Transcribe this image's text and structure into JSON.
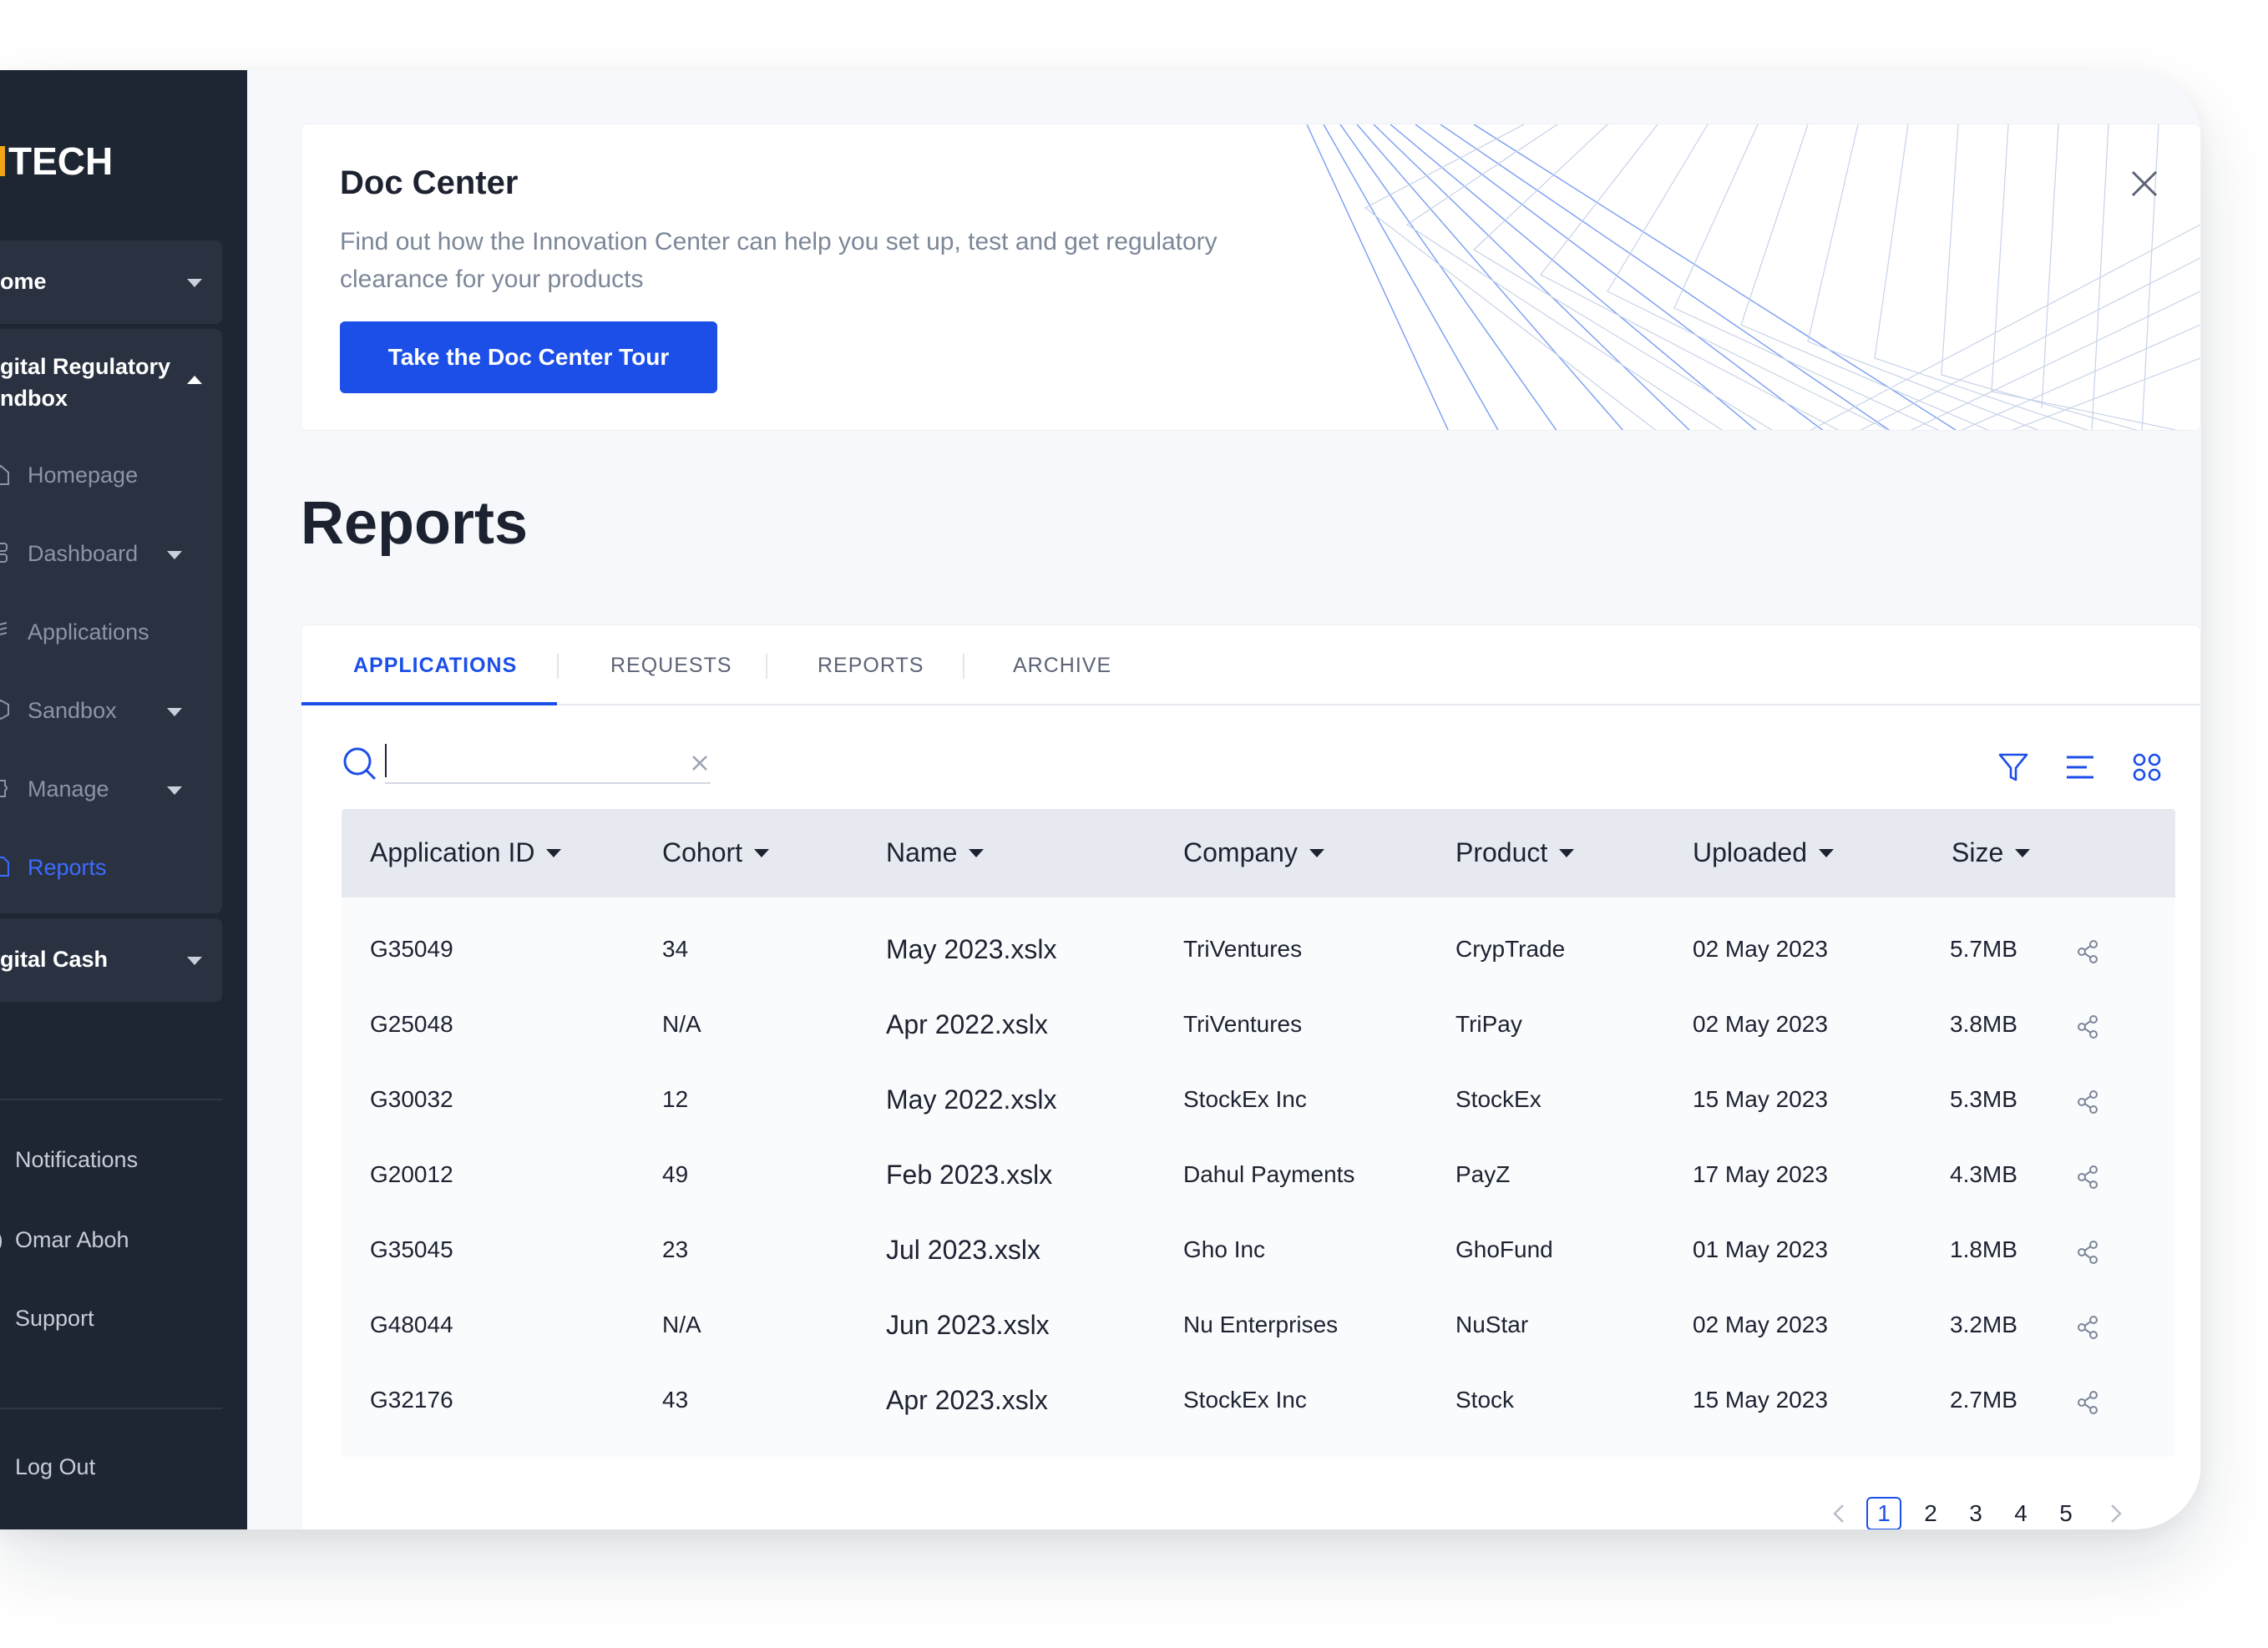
{
  "sidebar": {
    "logo": "TECH",
    "home": "ome",
    "group_title_line1": "gital Regulatory",
    "group_title_line2": "ndbox",
    "items": [
      {
        "label": "Homepage"
      },
      {
        "label": "Dashboard"
      },
      {
        "label": "Applications"
      },
      {
        "label": "Sandbox"
      },
      {
        "label": "Manage"
      },
      {
        "label": "Reports"
      }
    ],
    "cash": "gital Cash",
    "notifications": "Notifications",
    "user": "Omar Aboh",
    "support": "Support",
    "logout": "Log Out"
  },
  "banner": {
    "title": "Doc Center",
    "description": "Find out how the Innovation Center can help you set up, test and get regulatory clearance for your products",
    "button": "Take the Doc Center Tour"
  },
  "page_title": "Reports",
  "tabs": [
    "APPLICATIONS",
    "REQUESTS",
    "REPORTS",
    "ARCHIVE"
  ],
  "search": {
    "value": "",
    "placeholder": ""
  },
  "table": {
    "columns": [
      "Application ID",
      "Cohort",
      "Name",
      "Company",
      "Product",
      "Uploaded",
      "Size"
    ],
    "rows": [
      [
        "G35049",
        "34",
        "May 2023.xslx",
        "TriVentures",
        "CrypTrade",
        "02 May 2023",
        "5.7MB"
      ],
      [
        "G25048",
        "N/A",
        "Apr 2022.xslx",
        "TriVentures",
        "TriPay",
        "02 May 2023",
        "3.8MB"
      ],
      [
        "G30032",
        "12",
        "May 2022.xslx",
        "StockEx Inc",
        "StockEx",
        "15 May 2023",
        "5.3MB"
      ],
      [
        "G20012",
        "49",
        "Feb 2023.xslx",
        "Dahul Payments",
        "PayZ",
        "17 May 2023",
        "4.3MB"
      ],
      [
        "G35045",
        "23",
        "Jul 2023.xslx",
        "Gho Inc",
        "GhoFund",
        "01 May 2023",
        "1.8MB"
      ],
      [
        "G48044",
        "N/A",
        "Jun 2023.xslx",
        "Nu Enterprises",
        "NuStar",
        "02 May 2023",
        "3.2MB"
      ],
      [
        "G32176",
        "43",
        "Apr 2023.xslx",
        "StockEx Inc",
        "Stock",
        "15 May 2023",
        "2.7MB"
      ]
    ]
  },
  "pagination": {
    "pages": [
      "1",
      "2",
      "3",
      "4",
      "5"
    ],
    "current": "1"
  },
  "colors": {
    "accent": "#1c4fe8",
    "sidebar_bg": "#1f2633",
    "header_bg": "#e6e9f0"
  }
}
